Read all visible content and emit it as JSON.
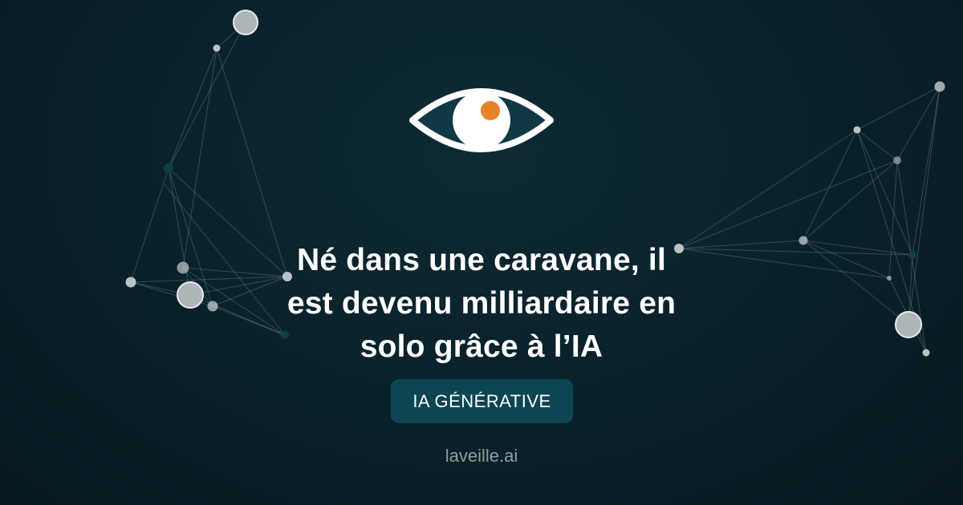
{
  "headline": {
    "line1": "Né dans une caravane, il",
    "line2": "est devenu milliardaire en",
    "line3": "solo grâce à l’IA"
  },
  "category_tag": {
    "label": "IA GÉNÉRATIVE"
  },
  "site": {
    "domain": "laveille.ai"
  },
  "logo": {
    "icon": "eye-icon"
  },
  "colors": {
    "background": "#0a2029",
    "accent_orange": "#e8832a",
    "tag_background": "#0d4653",
    "text_primary": "#ffffff",
    "text_muted": "#8b9ea3"
  }
}
